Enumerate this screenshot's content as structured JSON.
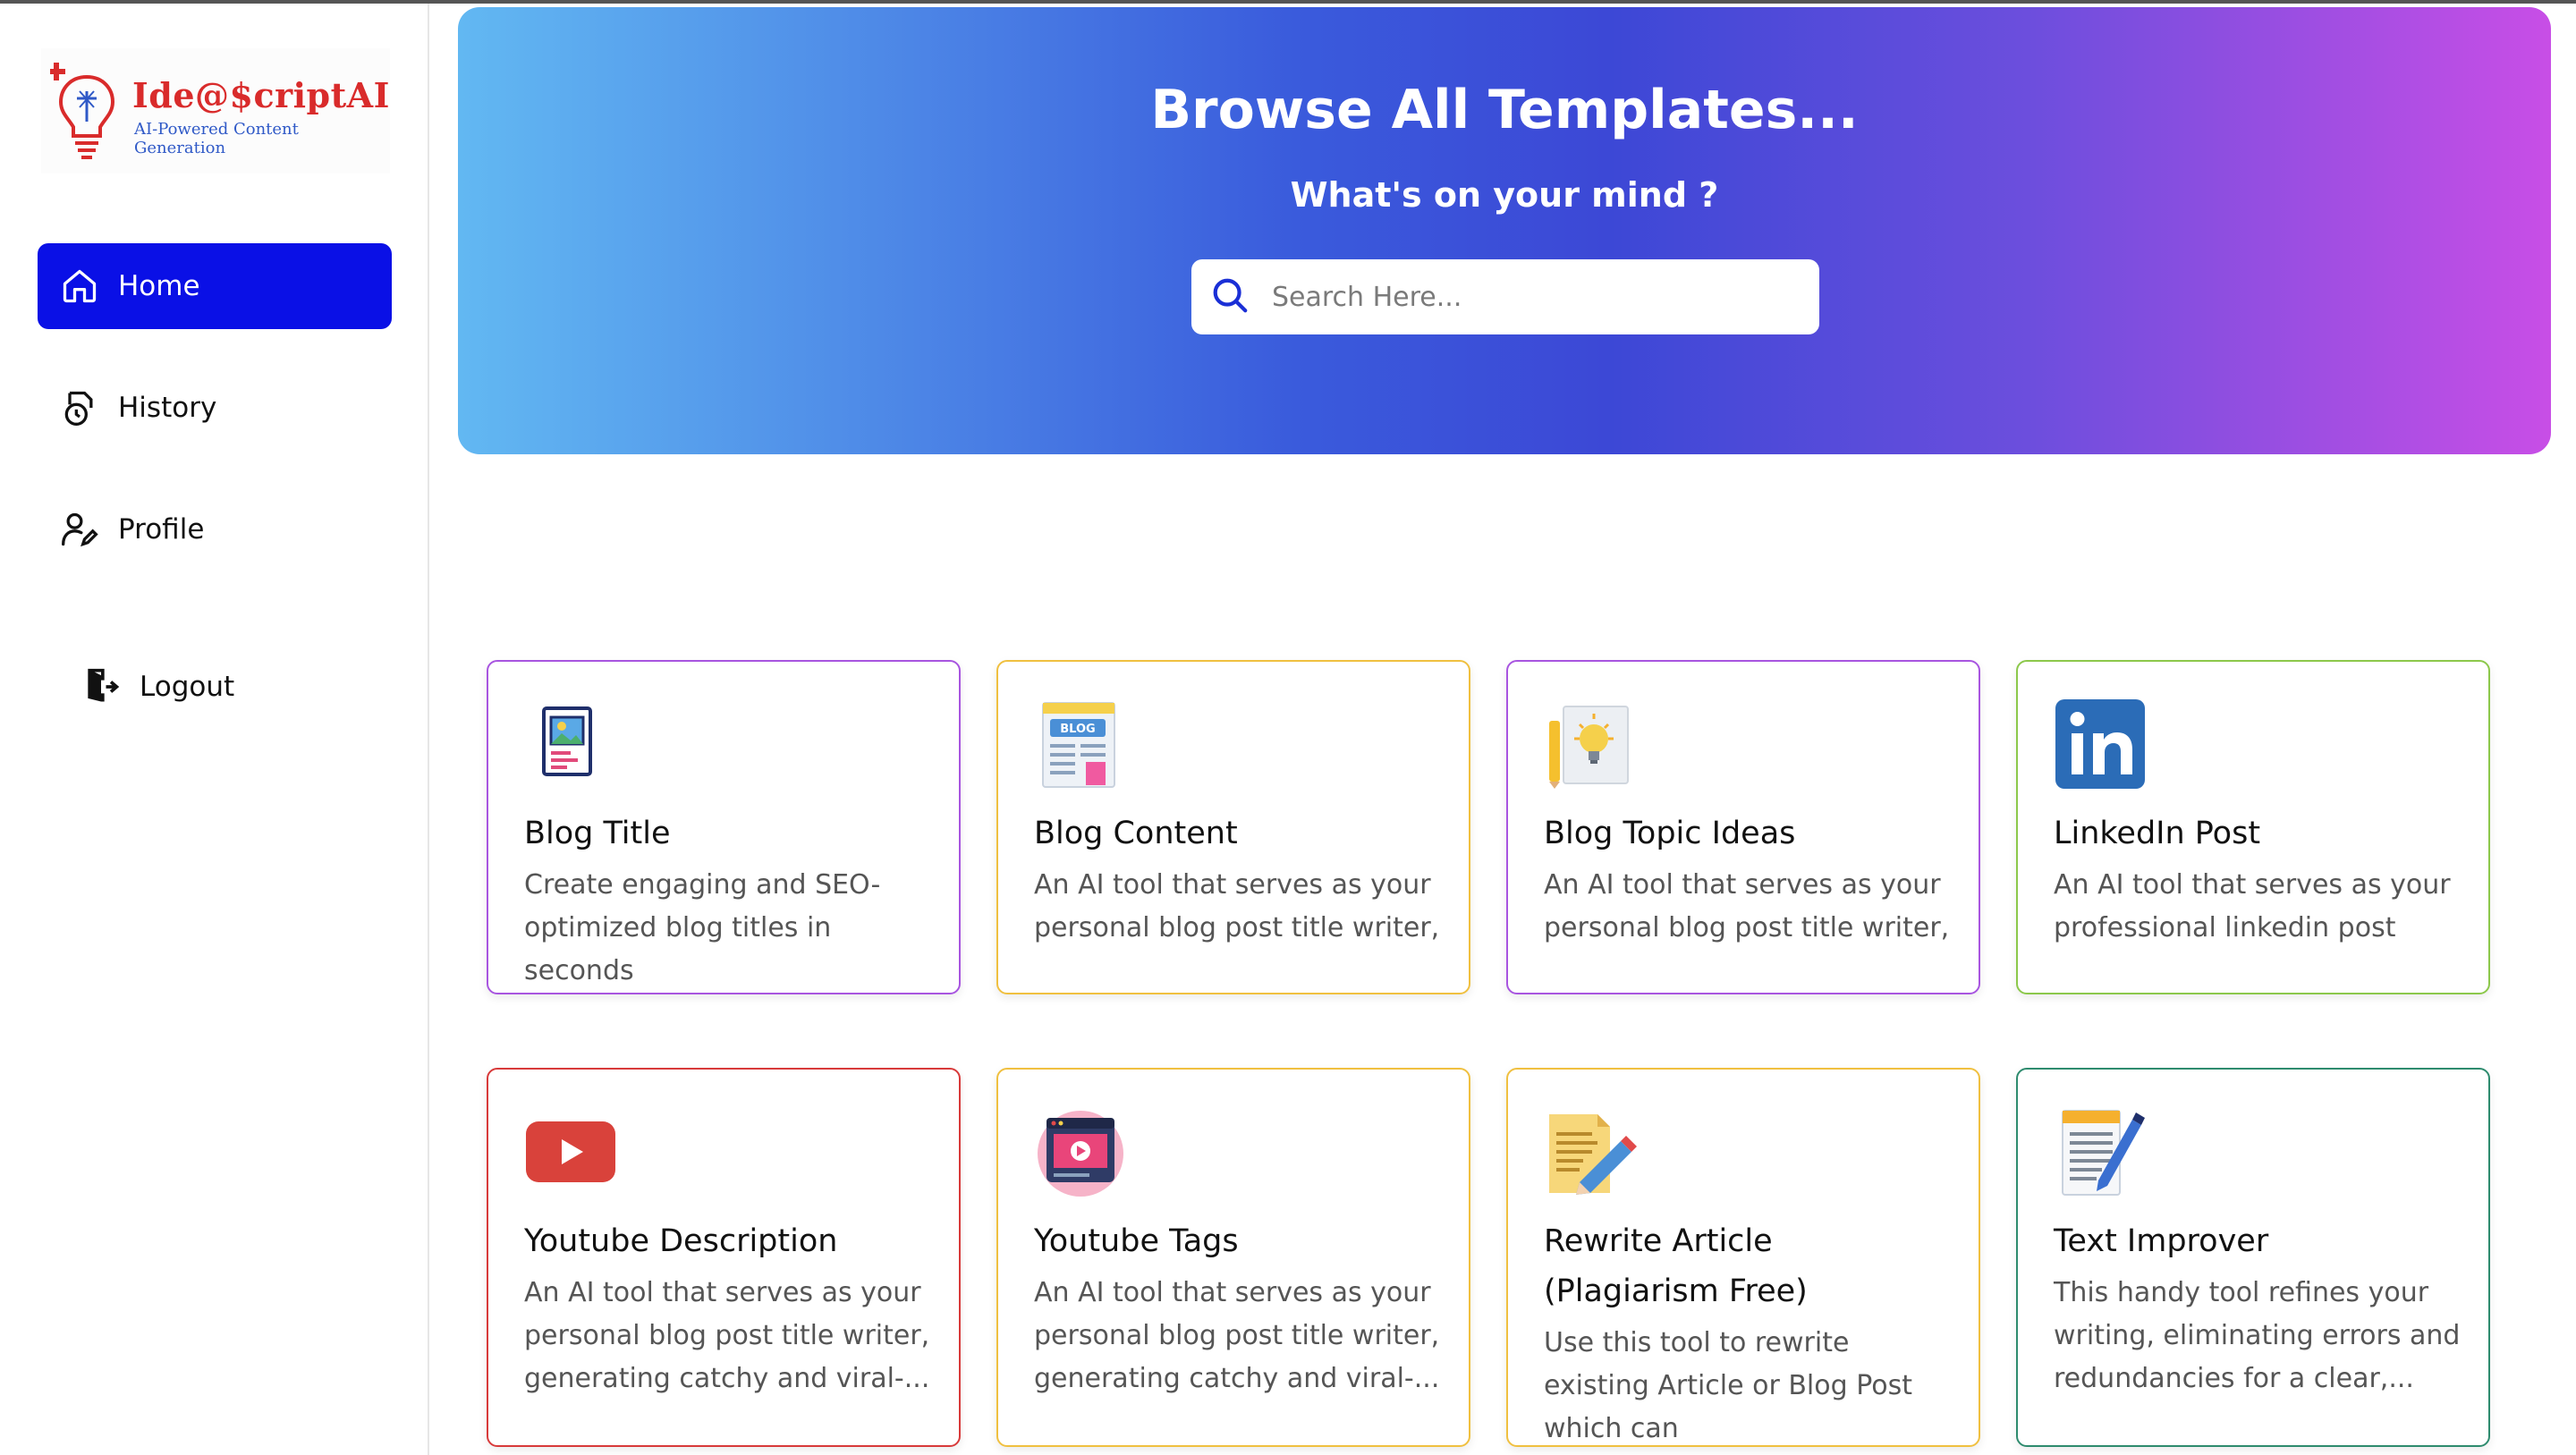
{
  "logo": {
    "title": "Ide@$criptAI",
    "subtitle": "AI-Powered Content Generation"
  },
  "sidebar": {
    "items": [
      {
        "label": "Home",
        "icon": "home-icon",
        "active": true
      },
      {
        "label": "History",
        "icon": "history-icon",
        "active": false
      },
      {
        "label": "Profile",
        "icon": "profile-icon",
        "active": false
      },
      {
        "label": "Logout",
        "icon": "logout-icon",
        "active": false
      }
    ]
  },
  "hero": {
    "title": "Browse All Templates...",
    "subtitle": "What's on your mind ?",
    "search_placeholder": "Search Here..."
  },
  "colors": {
    "accent": "#0a10e6",
    "hero_gradient": [
      "#62b8f2",
      "#3a5bdc",
      "#c84ee6"
    ]
  },
  "templates": [
    {
      "title": "Blog Title",
      "description": "Create engaging and SEO-optimized blog titles in seconds",
      "icon": "blog-title-icon",
      "border": "#a855e0"
    },
    {
      "title": "Blog Content",
      "description": "An AI tool that serves as your personal blog post title writer,",
      "icon": "blog-content-icon",
      "border": "#f0c040"
    },
    {
      "title": "Blog Topic Ideas",
      "description": "An AI tool that serves as your personal blog post title writer,",
      "icon": "lightbulb-icon",
      "border": "#a855e0"
    },
    {
      "title": "LinkedIn Post",
      "description": "An AI tool that serves as your professional linkedin post",
      "icon": "linkedin-icon",
      "border": "#8cc84b"
    },
    {
      "title": "Youtube Description",
      "description": "An AI tool that serves as your personal blog post title writer, generating catchy and viral-...",
      "icon": "youtube-icon",
      "border": "#d83a3a"
    },
    {
      "title": "Youtube Tags",
      "description": "An AI tool that serves as your personal blog post title writer, generating catchy and viral-...",
      "icon": "video-tags-icon",
      "border": "#f0c040"
    },
    {
      "title": "Rewrite Article (Plagiarism Free)",
      "description": "Use this tool to rewrite existing Article or Blog Post which can",
      "icon": "rewrite-icon",
      "border": "#f0c040"
    },
    {
      "title": "Text Improver",
      "description": "This handy tool refines your writing, eliminating errors and redundancies for a clear,...",
      "icon": "notepad-icon",
      "border": "#2e8b6e"
    }
  ]
}
